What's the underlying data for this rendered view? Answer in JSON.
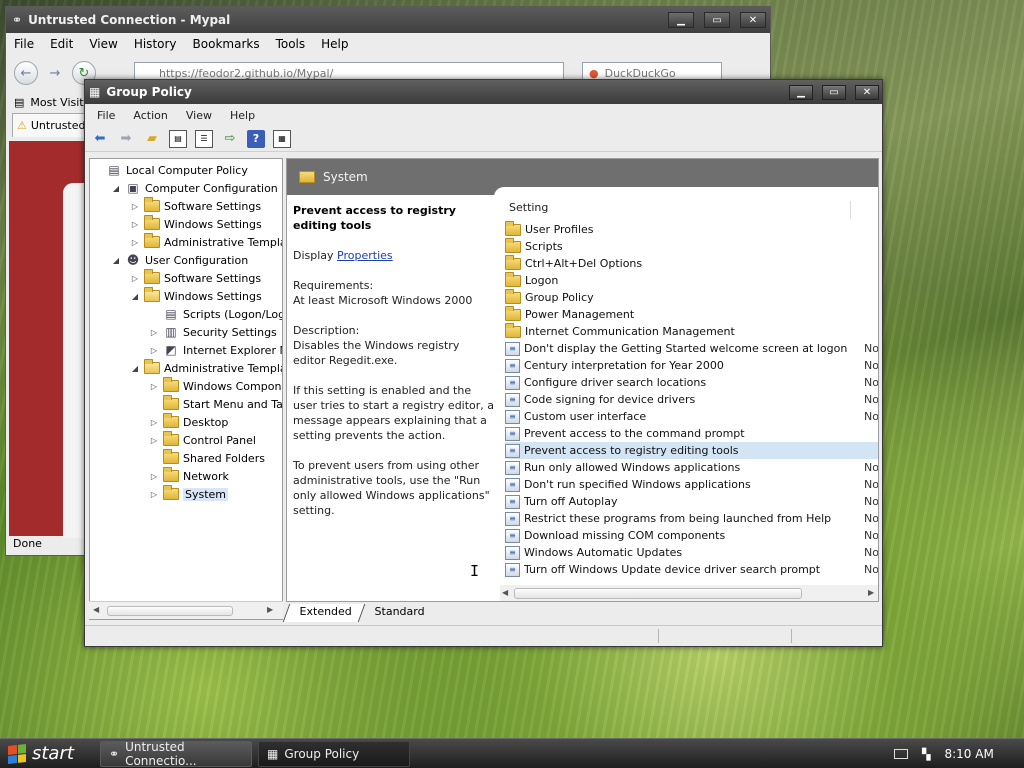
{
  "firefox": {
    "title": "Untrusted Connection - Mypal",
    "menu": [
      "File",
      "Edit",
      "View",
      "History",
      "Bookmarks",
      "Tools",
      "Help"
    ],
    "url": "https://feodor2.github.io/Mypal/",
    "search_placeholder": "DuckDuckGo",
    "bookmark": "Most Visite",
    "tab": "Untrusted",
    "status": "Done"
  },
  "gp": {
    "title": "Group Policy",
    "menu": [
      "File",
      "Action",
      "View",
      "Help"
    ],
    "tree": [
      {
        "label": "Local Computer Policy",
        "icon": "policy-icon",
        "toggle": ""
      },
      {
        "label": "Computer Configuration",
        "icon": "computer-icon",
        "toggle": "◢"
      },
      {
        "label": "Software Settings",
        "icon": "folder-icon",
        "toggle": "▷"
      },
      {
        "label": "Windows Settings",
        "icon": "folder-icon",
        "toggle": "▷"
      },
      {
        "label": "Administrative Templates",
        "icon": "folder-icon",
        "toggle": "▷"
      },
      {
        "label": "User Configuration",
        "icon": "user-icon",
        "toggle": "◢"
      },
      {
        "label": "Software Settings",
        "icon": "folder-icon",
        "toggle": "▷"
      },
      {
        "label": "Windows Settings",
        "icon": "folder-icon",
        "toggle": "◢"
      },
      {
        "label": "Scripts (Logon/Logoff)",
        "icon": "script-icon",
        "toggle": ""
      },
      {
        "label": "Security Settings",
        "icon": "security-icon",
        "toggle": "▷"
      },
      {
        "label": "Internet Explorer Maint",
        "icon": "ie-icon",
        "toggle": "▷"
      },
      {
        "label": "Administrative Templates",
        "icon": "folder-icon",
        "toggle": "◢"
      },
      {
        "label": "Windows Components",
        "icon": "folder-icon",
        "toggle": "▷"
      },
      {
        "label": "Start Menu and Taskba",
        "icon": "folder-icon",
        "toggle": ""
      },
      {
        "label": "Desktop",
        "icon": "folder-icon",
        "toggle": "▷"
      },
      {
        "label": "Control Panel",
        "icon": "folder-icon",
        "toggle": "▷"
      },
      {
        "label": "Shared Folders",
        "icon": "folder-icon",
        "toggle": ""
      },
      {
        "label": "Network",
        "icon": "folder-icon",
        "toggle": "▷"
      },
      {
        "label": "System",
        "icon": "folder-icon",
        "toggle": "▷"
      }
    ],
    "header": "System",
    "desc": {
      "title": "Prevent access to registry editing tools",
      "display_prefix": "Display",
      "display_link": "Properties",
      "req_label": "Requirements:",
      "req_value": "At least Microsoft Windows 2000",
      "desc_label": "Description:",
      "desc_value": "Disables the Windows registry editor Regedit.exe.",
      "p1": "If this setting is enabled and the user tries to start a registry editor, a message appears explaining that a setting prevents the action.",
      "p2": "To prevent users from using other administrative tools, use the \"Run only allowed Windows applications\" setting."
    },
    "column_setting": "Setting",
    "rows": [
      {
        "label": "User Profiles",
        "type": "folder",
        "state": ""
      },
      {
        "label": "Scripts",
        "type": "folder",
        "state": ""
      },
      {
        "label": "Ctrl+Alt+Del Options",
        "type": "folder",
        "state": ""
      },
      {
        "label": "Logon",
        "type": "folder",
        "state": ""
      },
      {
        "label": "Group Policy",
        "type": "folder",
        "state": ""
      },
      {
        "label": "Power Management",
        "type": "folder",
        "state": ""
      },
      {
        "label": "Internet Communication Management",
        "type": "folder",
        "state": ""
      },
      {
        "label": "Don't display the Getting Started welcome screen at logon",
        "type": "policy",
        "state": "Not"
      },
      {
        "label": "Century interpretation for Year 2000",
        "type": "policy",
        "state": "Not"
      },
      {
        "label": "Configure driver search locations",
        "type": "policy",
        "state": "Not"
      },
      {
        "label": "Code signing for device drivers",
        "type": "policy",
        "state": "Not"
      },
      {
        "label": "Custom user interface",
        "type": "policy",
        "state": "Not"
      },
      {
        "label": "Prevent access to the command prompt",
        "type": "policy",
        "state": ""
      },
      {
        "label": "Prevent access to registry editing tools",
        "type": "policy",
        "state": ""
      },
      {
        "label": "Run only allowed Windows applications",
        "type": "policy",
        "state": "Not"
      },
      {
        "label": "Don't run specified Windows applications",
        "type": "policy",
        "state": "Not"
      },
      {
        "label": "Turn off Autoplay",
        "type": "policy",
        "state": "Not"
      },
      {
        "label": "Restrict these programs from being launched from Help",
        "type": "policy",
        "state": "Not"
      },
      {
        "label": "Download missing COM components",
        "type": "policy",
        "state": "Not"
      },
      {
        "label": "Windows Automatic Updates",
        "type": "policy",
        "state": "Not"
      },
      {
        "label": "Turn off Windows Update device driver search prompt",
        "type": "policy",
        "state": "Not"
      }
    ],
    "tabs": [
      "Extended",
      "Standard"
    ]
  },
  "taskbar": {
    "start": "start",
    "tasks": [
      "Untrusted Connectio...",
      "Group Policy"
    ],
    "time": "8:10 AM"
  }
}
